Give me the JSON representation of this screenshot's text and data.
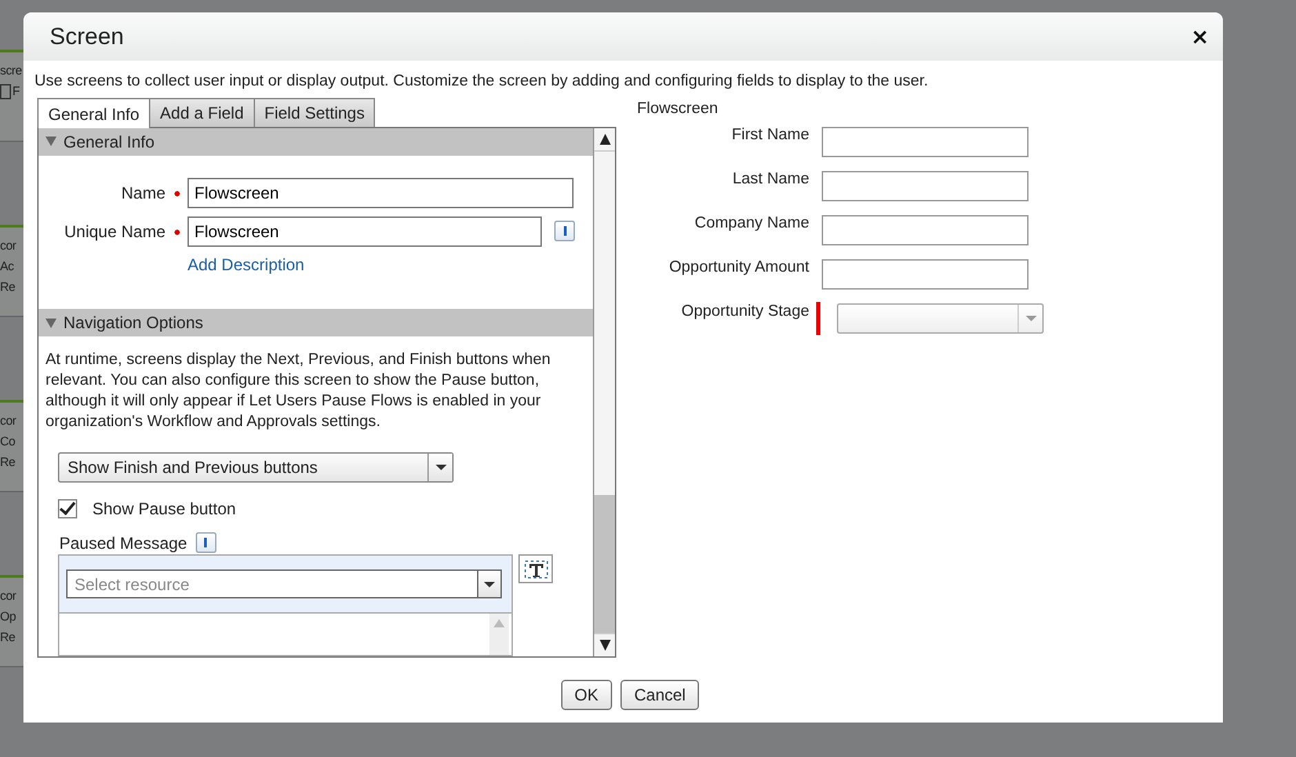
{
  "background": {
    "cards": [
      {
        "lines": [
          "scre",
          "F"
        ],
        "icon": true
      },
      {
        "lines": [
          "cor",
          "Ac",
          "Re"
        ],
        "icon": false
      },
      {
        "lines": [
          "cor",
          "Co",
          "Re"
        ],
        "icon": false
      },
      {
        "lines": [
          "cor",
          "Op",
          "Re"
        ],
        "icon": false
      }
    ]
  },
  "dialog": {
    "title": "Screen",
    "close": "×",
    "description": "Use screens to collect user input or display output. Customize the screen by adding and configuring fields to display to the user.",
    "tabs": [
      {
        "label": "General Info",
        "selected": true
      },
      {
        "label": "Add a Field",
        "selected": false
      },
      {
        "label": "Field Settings",
        "selected": false
      }
    ],
    "general_info": {
      "header": {
        "title": "General Info",
        "expanded": true
      },
      "name": {
        "label": "Name",
        "value": "Flowscreen",
        "required": true
      },
      "unique_name": {
        "label": "Unique Name",
        "value": "Flowscreen",
        "required": true
      },
      "add_description": "Add Description"
    },
    "navigation": {
      "header": {
        "title": "Navigation Options",
        "expanded": true
      },
      "help": "At runtime, screens display the Next, Previous, and Finish buttons when relevant. You can also configure this screen to show the Pause button, although it will only appear if Let Users Pause Flows is enabled in your organization's Workflow and Approvals settings.",
      "buttons_select": "Show Finish and Previous buttons",
      "show_pause": {
        "label": "Show Pause button",
        "checked": true
      },
      "paused_message": {
        "label": "Paused Message",
        "placeholder": "Select resource"
      }
    },
    "preview": {
      "title": "Flowscreen",
      "fields": [
        {
          "label": "First Name",
          "kind": "text",
          "required": false
        },
        {
          "label": "Last Name",
          "kind": "text",
          "required": false
        },
        {
          "label": "Company Name",
          "kind": "text",
          "required": false
        },
        {
          "label": "Opportunity Amount",
          "kind": "text",
          "required": false
        },
        {
          "label": "Opportunity Stage",
          "kind": "picklist",
          "required": true
        }
      ]
    },
    "buttons": [
      "OK",
      "Cancel"
    ]
  }
}
